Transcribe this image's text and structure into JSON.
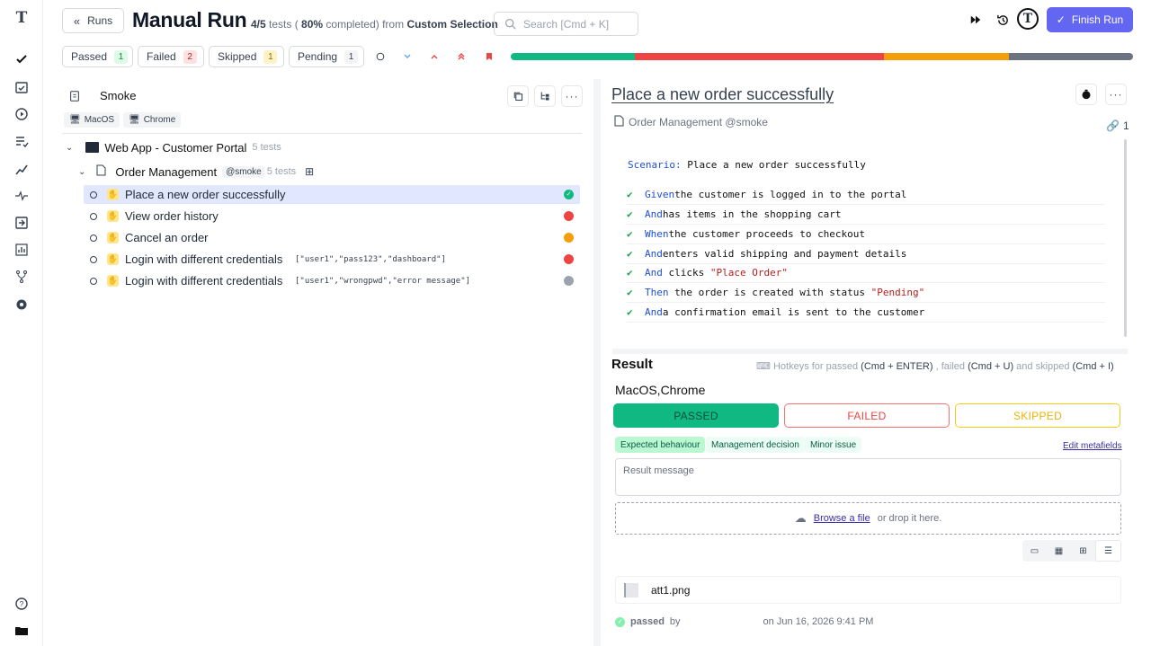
{
  "nav": {
    "runs_label": "Runs"
  },
  "header": {
    "title": "Manual Run",
    "progress_tests": "4/5",
    "progress_text_mid": " tests ( ",
    "progress_pct": "80%",
    "progress_text_end": " completed) from ",
    "selection": "Custom Selection",
    "search_placeholder": "Search [Cmd + K]",
    "finish_label": "Finish Run",
    "avatar_letter": "T"
  },
  "filters": [
    {
      "label": "Passed",
      "count": "1",
      "bg": "#dcfce7",
      "fg": "#15803d"
    },
    {
      "label": "Failed",
      "count": "2",
      "bg": "#fee2e2",
      "fg": "#b91c1c"
    },
    {
      "label": "Skipped",
      "count": "1",
      "bg": "#fef3c7",
      "fg": "#a16207"
    },
    {
      "label": "Pending",
      "count": "1",
      "bg": "#f3f4f6",
      "fg": "#374151"
    }
  ],
  "progress_bar": [
    {
      "status": "passed",
      "value": 1,
      "color": "#10b981"
    },
    {
      "status": "failed",
      "value": 2,
      "color": "#ef4444"
    },
    {
      "status": "skipped",
      "value": 1,
      "color": "#f59e0b"
    },
    {
      "status": "pending",
      "value": 1,
      "color": "#6b7280"
    }
  ],
  "tree": {
    "group": "Smoke",
    "tags": [
      "MacOS",
      "Chrome"
    ],
    "folder": {
      "name": "Web App - Customer Portal",
      "count": "5 tests"
    },
    "suite": {
      "name": "Order Management",
      "tag": "@smoke",
      "count": "5 tests"
    },
    "tests": [
      {
        "label": "Place a new order successfully",
        "params": "",
        "status_color": "#10b981"
      },
      {
        "label": "View order history",
        "params": "",
        "status_color": "#ef4444"
      },
      {
        "label": "Cancel an order",
        "params": "",
        "status_color": "#f59e0b"
      },
      {
        "label": "Login with different credentials",
        "params": "[\"user1\",\"pass123\",\"dashboard\"]",
        "status_color": "#ef4444"
      },
      {
        "label": "Login with different credentials",
        "params": "[\"user1\",\"wrongpwd\",\"error message\"]",
        "status_color": "#9ca3af"
      }
    ]
  },
  "detail": {
    "title": "Place a new order successfully",
    "breadcrumb": "Order Management @smoke",
    "links_count": "1",
    "scenario_kw": "Scenario:",
    "scenario_text": " Place a new order successfully",
    "steps": [
      {
        "kw": "Given",
        "text": " the customer is logged in to the portal",
        "str": ""
      },
      {
        "kw": "And",
        "text": " has items in the shopping cart",
        "str": ""
      },
      {
        "kw": "When",
        "text": " the customer proceeds to checkout",
        "str": ""
      },
      {
        "kw": "And",
        "text": " enters valid shipping and payment details",
        "str": ""
      },
      {
        "kw": "And",
        "text": " clicks ",
        "str": "\"Place Order\""
      },
      {
        "kw": "Then",
        "text": " the order is created with status ",
        "str": "\"Pending\""
      },
      {
        "kw": "And",
        "text": " a confirmation email is sent to the customer",
        "str": ""
      }
    ]
  },
  "result": {
    "heading": "Result",
    "hot_prefix": "Hotkeys for passed ",
    "hot_passed": "(Cmd + ENTER)",
    "hot_mid1": " , failed ",
    "hot_failed": "(Cmd + U)",
    "hot_mid2": " and skipped ",
    "hot_skipped": "(Cmd + I)",
    "env": "MacOS,Chrome",
    "passed": "PASSED",
    "failed": "FAILED",
    "skipped": "SKIPPED",
    "chips": [
      "Expected behaviour",
      "Management decision",
      "Minor issue"
    ],
    "edit_meta": "Edit metafields",
    "message_placeholder": "Result message",
    "browse": "Browse a file",
    "drop_text": "or drop it here.",
    "attachment": "att1.png",
    "passed_by": "passed",
    "by": "by",
    "date": "on Jun 16, 2026 9:41 PM"
  }
}
